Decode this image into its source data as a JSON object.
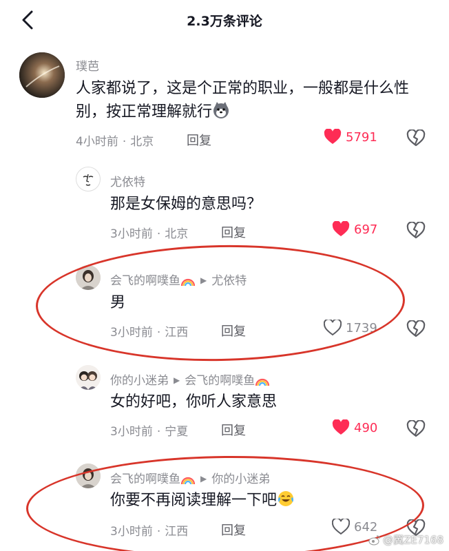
{
  "header": {
    "title": "2.3万条评论"
  },
  "comments": [
    {
      "username": "璞芭",
      "text": "人家都说了，这是个正常的职业，一般都是什么性别，按正常理解就行",
      "time": "4小时前",
      "location": "北京",
      "reply_label": "回复",
      "likes": "5791",
      "liked": true
    },
    {
      "username": "尤依特",
      "text": "那是女保姆的意思吗？",
      "time": "3小时前",
      "location": "北京",
      "reply_label": "回复",
      "likes": "697",
      "liked": true
    },
    {
      "username": "会飞的啊噗鱼",
      "reply_to": "尤依特",
      "text": "男",
      "time": "3小时前",
      "location": "江西",
      "reply_label": "回复",
      "likes": "1739",
      "liked": false
    },
    {
      "username": "你的小迷弟",
      "reply_to": "会飞的啊噗鱼",
      "text": "女的好吧，你听人家意思",
      "time": "3小时前",
      "location": "宁夏",
      "reply_label": "回复",
      "likes": "490",
      "liked": true
    },
    {
      "username": "会飞的啊噗鱼",
      "reply_to": "你的小迷弟",
      "text": "你要不再阅读理解一下吧",
      "time": "3小时前",
      "location": "江西",
      "reply_label": "回复",
      "likes": "642",
      "liked": false
    }
  ],
  "watermark": "@冀ZE7168",
  "colors": {
    "like_red": "#fe2c55",
    "annotation_red": "#d8352a",
    "muted_text": "#8a8b91"
  }
}
